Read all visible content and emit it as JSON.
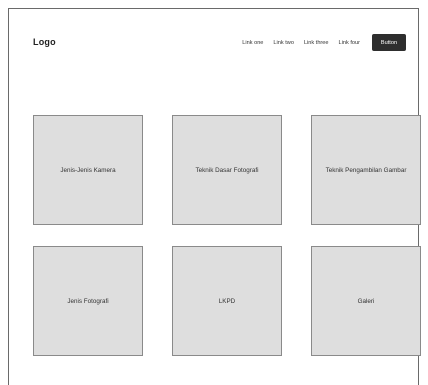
{
  "header": {
    "logo": "Logo",
    "nav_links": [
      "Link one",
      "Link two",
      "Link three",
      "Link four"
    ],
    "button_label": "Button"
  },
  "cards": [
    {
      "label": "Jenis-Jenis Kamera"
    },
    {
      "label": "Teknik Dasar Fotografi"
    },
    {
      "label": "Teknik Pengambilan Gambar"
    },
    {
      "label": "Jenis Fotografi"
    },
    {
      "label": "LKPD"
    },
    {
      "label": "Galeri"
    }
  ],
  "colors": {
    "card_fill": "#dedede",
    "button_fill": "#2e2e2e"
  }
}
